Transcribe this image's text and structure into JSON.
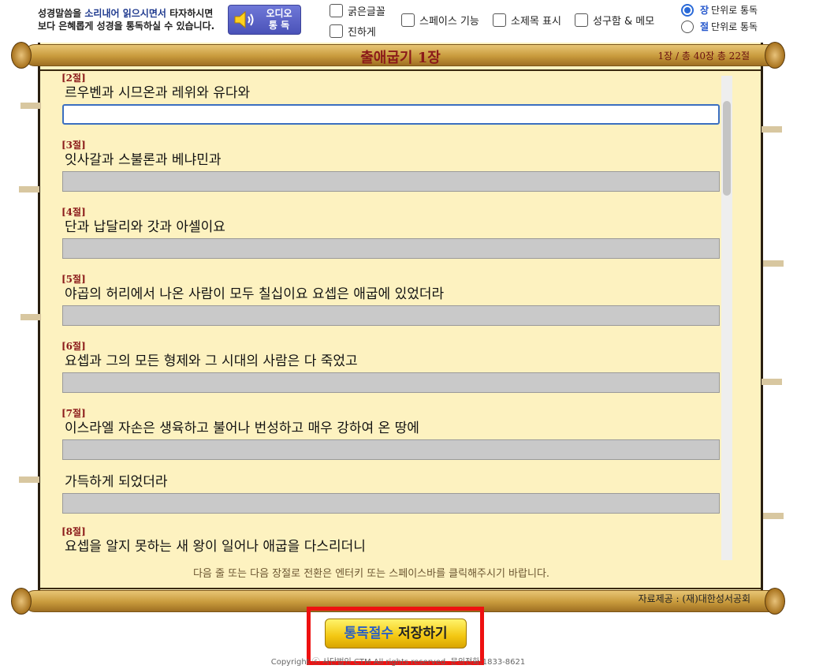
{
  "toolbar": {
    "notice_line1_a": "성경말씀을 ",
    "notice_line1_b": "소리내어 읽으시면서",
    "notice_line1_c": " 타자하시면",
    "notice_line2": "보다 은혜롭게 성경을 통독하실 수 있습니다.",
    "audio_label_1": "오디오",
    "audio_label_2": "통  독",
    "bold_font": "굵은글꼴",
    "darker": "진하게",
    "space_feature": "스페이스 기능",
    "subtitle_show": "소제목 표시",
    "phrase_memo": "성구함 & 메모",
    "radio_chapter_hl": "장",
    "radio_chapter": "단위로 통독",
    "radio_verse_hl": "절",
    "radio_verse": "단위로 통독"
  },
  "scroll": {
    "title": "출애굽기 1장",
    "counter": "1장 / 총 40장   총 22절",
    "hint": "다음 줄 또는 다음 장절로 전환은 엔터키 또는 스페이스바를 클릭해주시기 바랍니다.",
    "source": "자료제공 : (재)대한성서공회"
  },
  "verses": [
    {
      "num": "[2절]",
      "text": "르우벤과 시므온과 레위와 유다와"
    },
    {
      "num": "[3절]",
      "text": "잇사갈과 스불론과 베냐민과"
    },
    {
      "num": "[4절]",
      "text": "단과 납달리와 갓과 아셀이요"
    },
    {
      "num": "[5절]",
      "text": "야곱의 허리에서 나온 사람이 모두 칠십이요 요셉은 애굽에 있었더라"
    },
    {
      "num": "[6절]",
      "text": "요셉과 그의 모든 형제와 그 시대의 사람은 다 죽었고"
    },
    {
      "num": "[7절]",
      "text": "이스라엘 자손은 생육하고 불어나 번성하고 매우 강하여 온 땅에"
    },
    {
      "num": "",
      "text": "가득하게 되었더라"
    },
    {
      "num": "[8절]",
      "text": "요셉을 알지 못하는 새 왕이 일어나 애굽을 다스리더니"
    }
  ],
  "save": {
    "label_a": "통독절수",
    "label_b": " 저장하기"
  },
  "footer": {
    "copyright": "Copyright ⓒ 사단법인 CTM All rights reserved.  문의전화:1833-8621"
  },
  "colors": {
    "paper": "#fdf2c0",
    "title": "#8b1a1a",
    "save_highlight": "#ee1111",
    "save_button": "#f3c712"
  }
}
